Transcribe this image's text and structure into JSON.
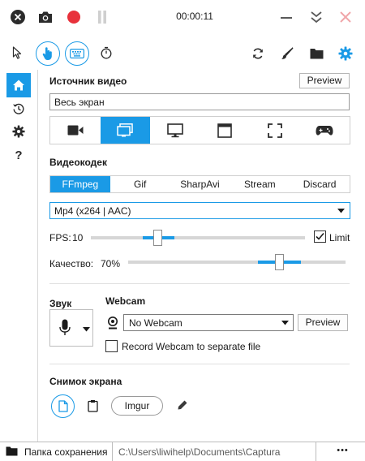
{
  "title_bar": {
    "timer": "00:00:11",
    "icons": [
      "close-circle-icon",
      "camera-icon",
      "record-icon",
      "pause-icon",
      "minimize-icon",
      "collapse-icon",
      "close-icon"
    ]
  },
  "toolbar": {
    "left_icons": [
      "cursor-icon",
      "click-hand-icon",
      "keyboard-icon",
      "timer-icon"
    ],
    "right_icons": [
      "refresh-icon",
      "brush-icon",
      "folder-icon",
      "settings-icon"
    ],
    "accent_color": "#1a9ae6"
  },
  "sidebar": {
    "items": [
      "home-icon",
      "history-icon",
      "settings-icon",
      "help-icon"
    ]
  },
  "video_source": {
    "title": "Источник видео",
    "preview_label": "Preview",
    "value": "Весь экран",
    "source_icons": [
      "webcam-icon",
      "screen-icon",
      "monitor-icon",
      "window-icon",
      "region-icon",
      "gamepad-icon"
    ],
    "selected_index": 1
  },
  "codec": {
    "title": "Видеокодек",
    "tabs": [
      "FFmpeg",
      "Gif",
      "SharpAvi",
      "Stream",
      "Discard"
    ],
    "selected_tab": 0,
    "format": "Mp4 (x264 | AAC)",
    "fps_label": "FPS:",
    "fps_value": "10",
    "limit_label": "Limit",
    "limit_checked": true,
    "quality_label": "Качество:",
    "quality_value": "70%"
  },
  "audio": {
    "title": "Звук"
  },
  "webcam": {
    "title": "Webcam",
    "selected": "No Webcam",
    "preview_label": "Preview",
    "separate_file_label": "Record Webcam to separate file",
    "separate_file_checked": false
  },
  "screenshot": {
    "title": "Снимок экрана",
    "imgur_label": "Imgur"
  },
  "status_bar": {
    "folder_label": "Папка сохранения",
    "path": "C:\\Users\\liwihelp\\Documents\\Captura",
    "more_label": "•••"
  }
}
